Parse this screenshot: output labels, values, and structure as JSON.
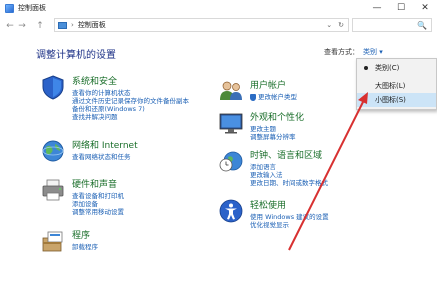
{
  "window": {
    "title": "控制面板",
    "minimize_glyph": "—",
    "maximize_glyph": "☐",
    "close_glyph": "✕"
  },
  "address": {
    "back_glyph": "←",
    "forward_glyph": "→",
    "up_glyph": "↑",
    "separator": "›",
    "path": "控制面板",
    "dropdown_glyph": "⌄",
    "refresh_glyph": "↻",
    "search_glyph": "🔍"
  },
  "page": {
    "title": "调整计算机的设置",
    "view_by_label": "查看方式：",
    "view_by_value": "类别 ▾"
  },
  "categories": {
    "security": {
      "title": "系统和安全",
      "links": [
        "查看你的计算机状态",
        "通过文件历史记录保存你的文件备份副本",
        "备份和还原(Windows 7)",
        "查找并解决问题"
      ]
    },
    "network": {
      "title": "网络和 Internet",
      "links": [
        "查看网络状态和任务"
      ]
    },
    "hardware": {
      "title": "硬件和声音",
      "links": [
        "查看设备和打印机",
        "添加设备",
        "调整常用移动设置"
      ]
    },
    "programs": {
      "title": "程序",
      "links": [
        "卸载程序"
      ]
    },
    "accounts": {
      "title": "用户帐户",
      "links": [
        "更改帐户类型"
      ]
    },
    "appearance": {
      "title": "外观和个性化",
      "links": [
        "更改主题",
        "调整屏幕分辨率"
      ]
    },
    "clock": {
      "title": "时钟、语言和区域",
      "links": [
        "添加语言",
        "更改输入法",
        "更改日期、时间或数字格式"
      ]
    },
    "ease": {
      "title": "轻松使用",
      "links": [
        "使用 Windows 建议的设置",
        "优化视觉显示"
      ]
    }
  },
  "view_menu": {
    "items": [
      "类别(C)",
      "大图标(L)",
      "小图标(S)"
    ],
    "checked_index": 0,
    "highlighted_index": 2
  },
  "colors": {
    "category_title": "#1a6e2a",
    "link": "#1a5fb4",
    "heading": "#1e3287",
    "menu_highlight": "#cce4f7",
    "annotation_arrow": "#d83030"
  }
}
